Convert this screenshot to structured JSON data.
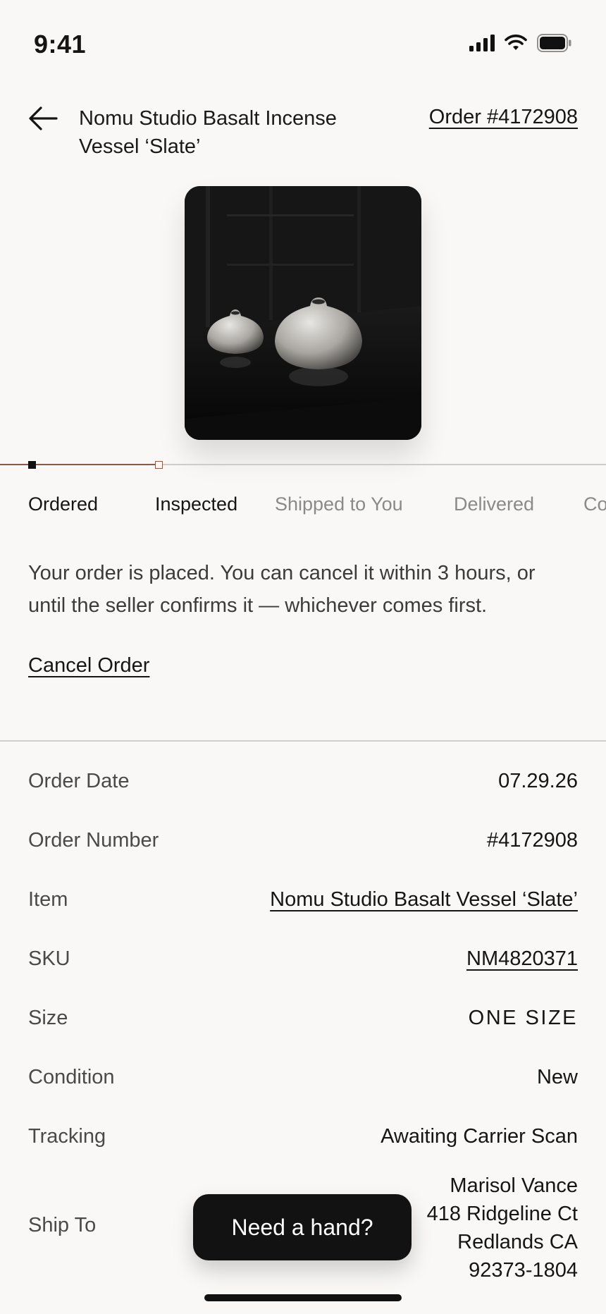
{
  "status_bar": {
    "time": "9:41"
  },
  "header": {
    "title": "Nomu Studio Basalt Incense Vessel ‘Slate’",
    "order_link": "Order #4172908"
  },
  "steps": [
    "Ordered",
    "Inspected",
    "Shipped to You",
    "Delivered",
    "Co"
  ],
  "current_step_progress": 0.2,
  "message": "Your order is placed. You can cancel it within 3 hours, or until the seller confirms it — whichever comes first.",
  "cancel_label": "Cancel Order",
  "details": {
    "order_date": {
      "label": "Order Date",
      "value": "07.29.26"
    },
    "order_number": {
      "label": "Order Number",
      "value": "#4172908"
    },
    "item": {
      "label": "Item",
      "value": "Nomu Studio Basalt Vessel ‘Slate’"
    },
    "sku": {
      "label": "SKU",
      "value": "NM4820371"
    },
    "size": {
      "label": "Size",
      "value": "ONE SIZE"
    },
    "condition": {
      "label": "Condition",
      "value": "New"
    },
    "tracking": {
      "label": "Tracking",
      "value": "Awaiting Carrier Scan"
    },
    "ship_to": {
      "label": "Ship To",
      "lines": [
        "Marisol Vance",
        "418 Ridgeline Ct",
        "Redlands CA",
        "92373-1804"
      ]
    }
  },
  "help_button": "Need a hand?",
  "colors": {
    "accent": "#8a5a44",
    "background": "#f9f8f6",
    "button": "#121212"
  }
}
